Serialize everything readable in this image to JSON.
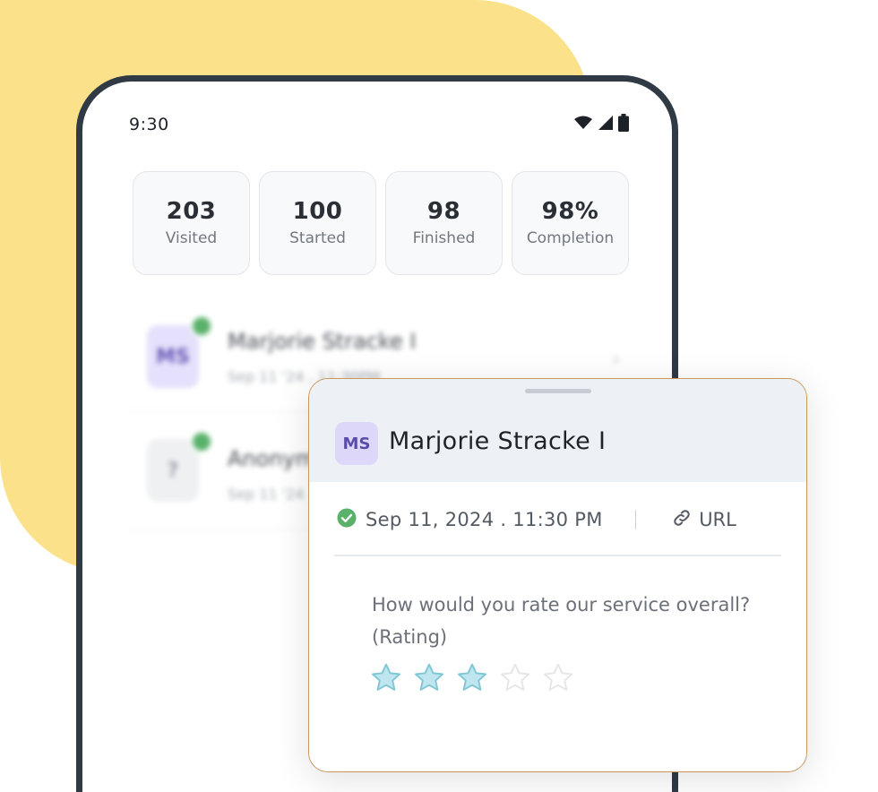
{
  "status_bar": {
    "time": "9:30",
    "icons": [
      "wifi-icon",
      "signal-icon",
      "battery-icon"
    ]
  },
  "stats": [
    {
      "value": "203",
      "label": "Visited"
    },
    {
      "value": "100",
      "label": "Started"
    },
    {
      "value": "98",
      "label": "Finished"
    },
    {
      "value": "98%",
      "label": "Completion"
    }
  ],
  "responses": [
    {
      "initials": "MS",
      "name": "Marjorie Stracke I",
      "date": "Sep 11 '24 . 11:30PM",
      "completed": true
    },
    {
      "initials": "?",
      "name": "Anonymous",
      "date": "Sep 11 '24",
      "completed": true
    }
  ],
  "detail": {
    "initials": "MS",
    "name": "Marjorie Stracke I",
    "date": "Sep 11, 2024 . 11:30 PM",
    "url_label": "URL",
    "question": "How would you rate our service overall? (Rating)",
    "rating": 3,
    "rating_max": 5
  },
  "colors": {
    "background_blob": "#fbe28a",
    "phone_frame": "#2f3a45",
    "accent_purple": "#5b4ba8",
    "check_green": "#59b16a",
    "star_filled": "#bfe6ee",
    "star_outline": "#7fc7d6",
    "card_border": "#c8975a"
  }
}
